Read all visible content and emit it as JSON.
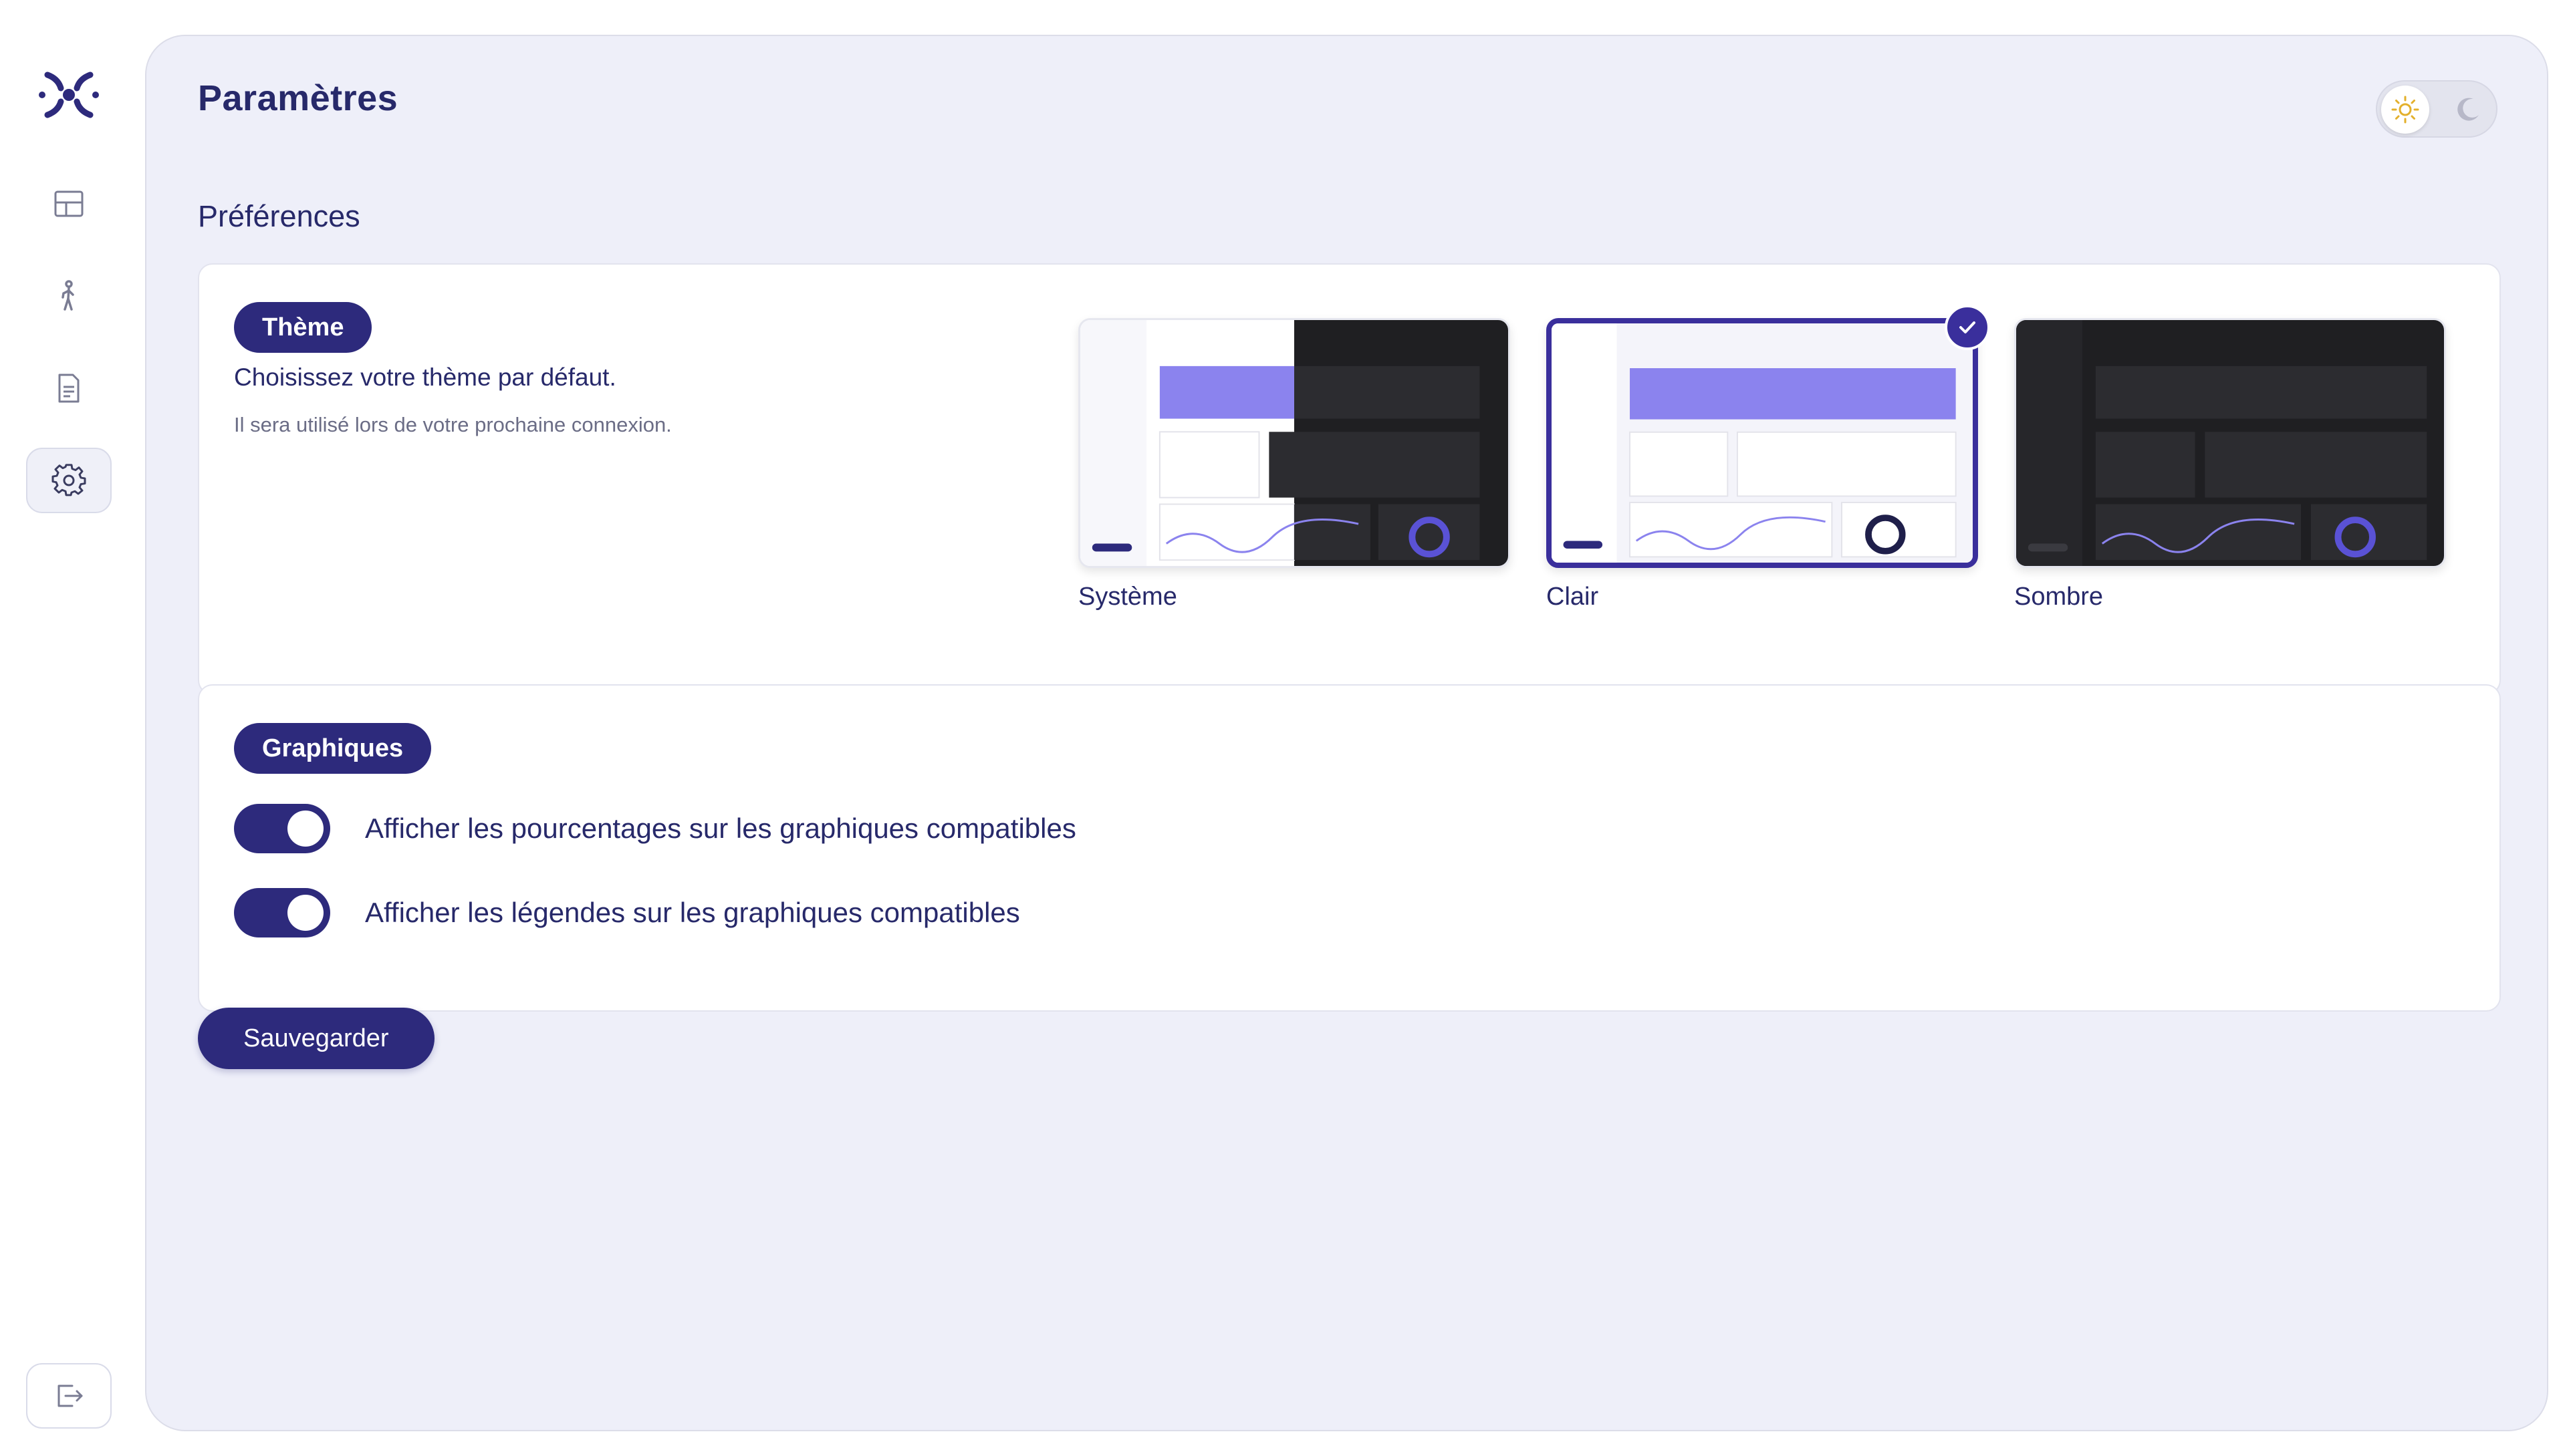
{
  "app": {
    "page_title": "Paramètres",
    "section_title": "Préférences"
  },
  "colors": {
    "brand": "#2d2a7c",
    "panel_bg": "#eeeff9",
    "text": "#27296a"
  },
  "sidebar": {
    "items": [
      {
        "name": "dashboard",
        "icon": "layout-icon",
        "active": false
      },
      {
        "name": "participants",
        "icon": "person-walking-icon",
        "active": false
      },
      {
        "name": "documents",
        "icon": "document-icon",
        "active": false
      },
      {
        "name": "settings",
        "icon": "gear-icon",
        "active": true
      }
    ],
    "logout_icon": "logout-icon"
  },
  "mode_toggle": {
    "light_icon": "sun-icon",
    "dark_icon": "moon-icon",
    "active": "light"
  },
  "theme_card": {
    "badge": "Thème",
    "description": "Choisissez votre thème par défaut.",
    "note": "Il sera utilisé lors de votre prochaine connexion.",
    "options": [
      {
        "id": "system",
        "label": "Système",
        "selected": false
      },
      {
        "id": "light",
        "label": "Clair",
        "selected": true
      },
      {
        "id": "dark",
        "label": "Sombre",
        "selected": false
      }
    ]
  },
  "charts_card": {
    "badge": "Graphiques",
    "toggles": [
      {
        "label": "Afficher les pourcentages sur les graphiques compatibles",
        "on": true
      },
      {
        "label": "Afficher les légendes sur les graphiques compatibles",
        "on": true
      }
    ]
  },
  "actions": {
    "save_label": "Sauvegarder"
  }
}
